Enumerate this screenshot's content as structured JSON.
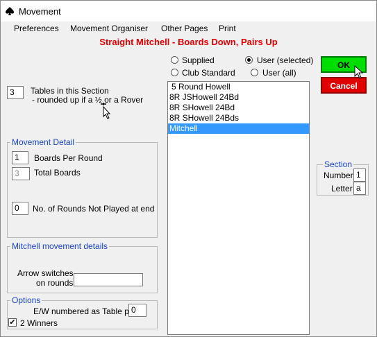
{
  "window": {
    "title": "Movement",
    "icon": "spade-icon"
  },
  "menu": [
    "Preferences",
    "Movement Organiser",
    "Other Pages",
    "Print"
  ],
  "heading": "Straight Mitchell - Boards Down, Pairs Up",
  "tables": {
    "value": "3",
    "label": "Tables in this Section",
    "note": "- rounded up if a ½ or a Rover"
  },
  "movement_detail": {
    "legend": "Movement Detail",
    "boards_per_round": {
      "value": "1",
      "label": "Boards Per Round"
    },
    "total_boards": {
      "value": "3",
      "label": "Total  Boards"
    },
    "rounds_not_played": {
      "value": "0",
      "label": "No. of Rounds Not Played at end"
    }
  },
  "mitchell": {
    "legend": "Mitchell movement details",
    "arrow_label_1": "Arrow switches",
    "arrow_label_2": "on rounds",
    "arrow_value": ""
  },
  "options": {
    "legend": "Options",
    "ew_label": "E/W numbered as  Table plus",
    "ew_value": "0",
    "two_winners_label": "2 Winners",
    "two_winners_checked": "✔"
  },
  "source": {
    "supplied": "Supplied",
    "user_selected": "User (selected)",
    "club_standard": "Club Standard",
    "user_all": "User (all)",
    "selected": "user_selected"
  },
  "movements": [
    "5 Round Howell",
    "8R JSHowell 24Bd",
    "8R SHowell 24Bd",
    "8R SHowell 24Bds",
    "Mitchell"
  ],
  "selected_movement": "Mitchell",
  "buttons": {
    "ok": "OK",
    "cancel": "Cancel"
  },
  "section": {
    "legend": "Section",
    "number_label": "Number",
    "number_value": "1",
    "letter_label": "Letter",
    "letter_value": "a"
  },
  "colors": {
    "heading": "#e00000",
    "legend": "#1a44c8",
    "ok": "#00dd00",
    "cancel": "#e00000",
    "selection": "#3399ff"
  }
}
